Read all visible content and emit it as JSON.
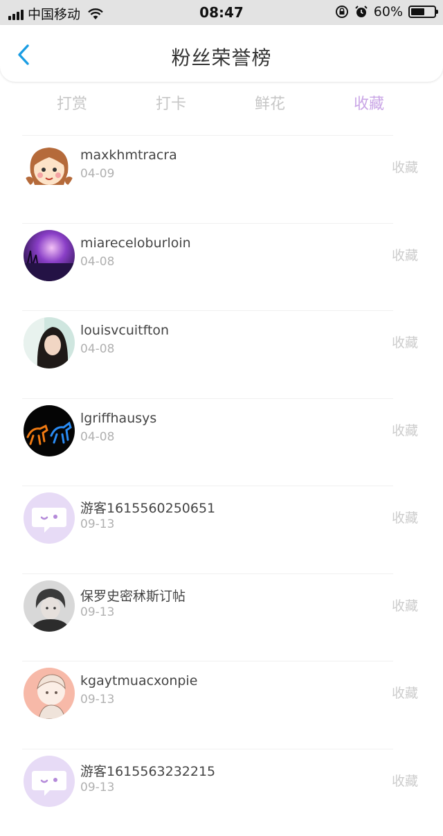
{
  "status_bar": {
    "carrier": "中国移动",
    "time": "08:47",
    "battery_percent": "60%",
    "battery_level": 0.6
  },
  "nav": {
    "title": "粉丝荣誉榜",
    "back_icon": "chevron-left-icon",
    "accent_color": "#1a9de3"
  },
  "tabs": [
    {
      "label": "打赏"
    },
    {
      "label": "打卡"
    },
    {
      "label": "鲜花"
    },
    {
      "label": "收藏",
      "active": true
    }
  ],
  "active_color": "#c9a5e6",
  "fans": [
    {
      "name": "maxkhmtracra",
      "date": "04-09",
      "action": "收藏",
      "avatar": "cartoon-girl-avatar"
    },
    {
      "name": "miareceloburloin",
      "date": "04-08",
      "action": "收藏",
      "avatar": "purple-sunset-avatar"
    },
    {
      "name": "louisvcuitfton",
      "date": "04-08",
      "action": "收藏",
      "avatar": "woman-photo-avatar"
    },
    {
      "name": "lgriffhausys",
      "date": "04-08",
      "action": "收藏",
      "avatar": "glowing-horses-avatar"
    },
    {
      "name": "游客1615560250651",
      "date": "09-13",
      "action": "收藏",
      "avatar": "default-chat-bubble-avatar"
    },
    {
      "name": "保罗史密秫斯订帖",
      "date": "09-13",
      "action": "收藏",
      "avatar": "boy-photo-avatar"
    },
    {
      "name": "kgaytmuacxonpie",
      "date": "09-13",
      "action": "收藏",
      "avatar": "anime-sketch-avatar"
    },
    {
      "name": "游客1615563232215",
      "date": "09-13",
      "action": "收藏",
      "avatar": "default-chat-bubble-avatar"
    }
  ]
}
